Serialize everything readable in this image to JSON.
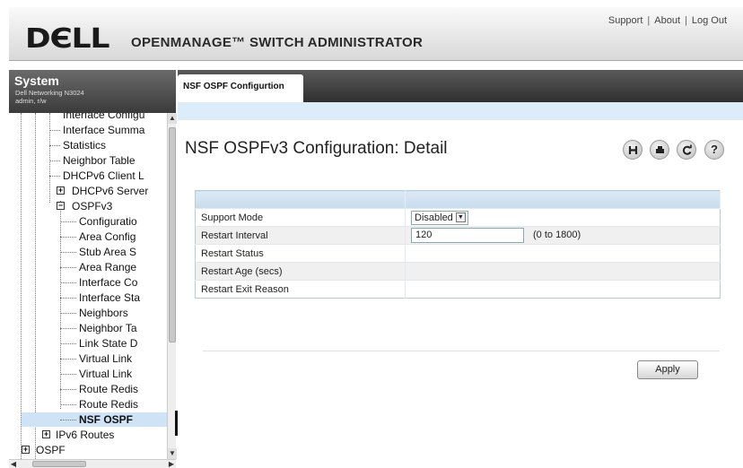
{
  "header": {
    "brand": "DЄLL",
    "app_title": "OPENMANAGE™ SWITCH ADMINISTRATOR",
    "links": [
      "Support",
      "About",
      "Log Out"
    ]
  },
  "system": {
    "title": "System",
    "device": "Dell Networking N3024",
    "user": "admin, r/w"
  },
  "nav_tree": {
    "items": [
      {
        "label": "Interface Configu"
      },
      {
        "label": "Interface Summa"
      },
      {
        "label": "Statistics"
      },
      {
        "label": "Neighbor Table"
      },
      {
        "label": "DHCPv6 Client L"
      },
      {
        "label": "DHCPv6 Server"
      },
      {
        "label": "OSPFv3"
      },
      {
        "label": "Configuratio"
      },
      {
        "label": "Area Config"
      },
      {
        "label": "Stub Area S"
      },
      {
        "label": "Area Range"
      },
      {
        "label": "Interface Co"
      },
      {
        "label": "Interface Sta"
      },
      {
        "label": "Neighbors"
      },
      {
        "label": "Neighbor Ta"
      },
      {
        "label": "Link State D"
      },
      {
        "label": "Virtual Link"
      },
      {
        "label": "Virtual Link"
      },
      {
        "label": "Route Redis"
      },
      {
        "label": "Route Redis"
      },
      {
        "label": "NSF OSPF"
      },
      {
        "label": "IPv6 Routes"
      },
      {
        "label": "OSPF"
      }
    ]
  },
  "tab": {
    "label": "NSF OSPF Configurtion"
  },
  "page": {
    "title": "NSF OSPFv3 Configuration: Detail",
    "icons": [
      "save-icon",
      "print-icon",
      "refresh-icon",
      "help-icon"
    ]
  },
  "form": {
    "rows": [
      {
        "label": "Support Mode",
        "value": "Disabled"
      },
      {
        "label": "Restart Interval",
        "value": "120",
        "hint": "(0 to 1800)"
      },
      {
        "label": "Restart Status",
        "value": ""
      },
      {
        "label": "Restart Age (secs)",
        "value": ""
      },
      {
        "label": "Restart Exit Reason",
        "value": ""
      }
    ]
  },
  "actions": {
    "apply_label": "Apply"
  }
}
